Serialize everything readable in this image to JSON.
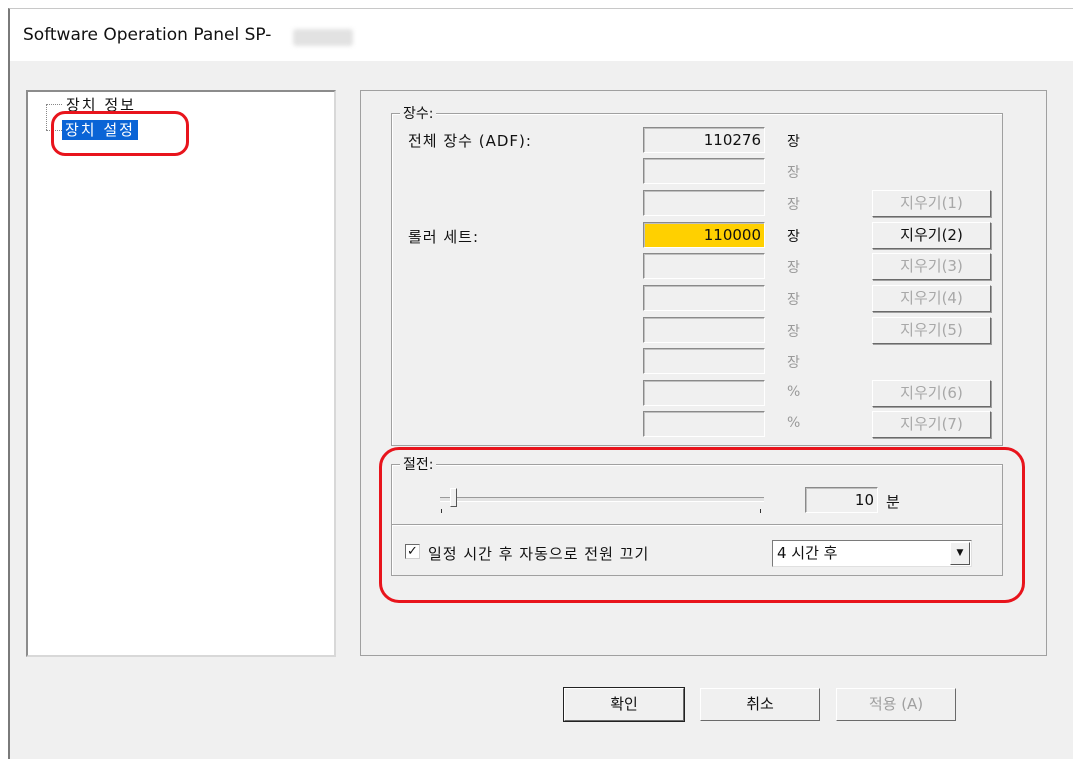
{
  "window": {
    "title": "Software Operation Panel SP-"
  },
  "tree": {
    "items": [
      {
        "label": "장치 정보",
        "selected": false
      },
      {
        "label": "장치 설정",
        "selected": true
      }
    ]
  },
  "page_count_group": {
    "title": "장수:",
    "rows": [
      {
        "label": "전체 장수 (ADF):",
        "value": "110276",
        "unit": "장",
        "unit_enabled": true,
        "highlight": false
      },
      {
        "label": "",
        "value": "",
        "unit": "장",
        "unit_enabled": false,
        "highlight": false
      },
      {
        "label": "",
        "value": "",
        "unit": "장",
        "unit_enabled": false,
        "highlight": false,
        "button": "지우기(1)",
        "button_enabled": false
      },
      {
        "label": "롤러 세트:",
        "value": "110000",
        "unit": "장",
        "unit_enabled": true,
        "highlight": true,
        "button": "지우기(2)",
        "button_enabled": true
      },
      {
        "label": "",
        "value": "",
        "unit": "장",
        "unit_enabled": false,
        "highlight": false,
        "button": "지우기(3)",
        "button_enabled": false
      },
      {
        "label": "",
        "value": "",
        "unit": "장",
        "unit_enabled": false,
        "highlight": false,
        "button": "지우기(4)",
        "button_enabled": false
      },
      {
        "label": "",
        "value": "",
        "unit": "장",
        "unit_enabled": false,
        "highlight": false,
        "button": "지우기(5)",
        "button_enabled": false
      },
      {
        "label": "",
        "value": "",
        "unit": "장",
        "unit_enabled": false,
        "highlight": false
      },
      {
        "label": "",
        "value": "",
        "unit": "%",
        "unit_enabled": false,
        "highlight": false,
        "button": "지우기(6)",
        "button_enabled": false
      },
      {
        "label": "",
        "value": "",
        "unit": "%",
        "unit_enabled": false,
        "highlight": false,
        "button": "지우기(7)",
        "button_enabled": false
      }
    ]
  },
  "power_saving": {
    "title": "절전:",
    "slider_value": "10",
    "slider_unit": "분",
    "auto_off_checked": true,
    "checkbox_mark": "✓",
    "auto_off_label": "일정 시간 후 자동으로 전원 끄기",
    "auto_off_selected": "4 시간 후",
    "dropdown_arrow": "▼"
  },
  "dialog_buttons": {
    "ok": "확인",
    "cancel": "취소",
    "apply": "적용 (A)"
  },
  "colors": {
    "highlight_field": "#ffd000",
    "selection": "#0a64d6",
    "annotation_red": "#e8141c"
  }
}
